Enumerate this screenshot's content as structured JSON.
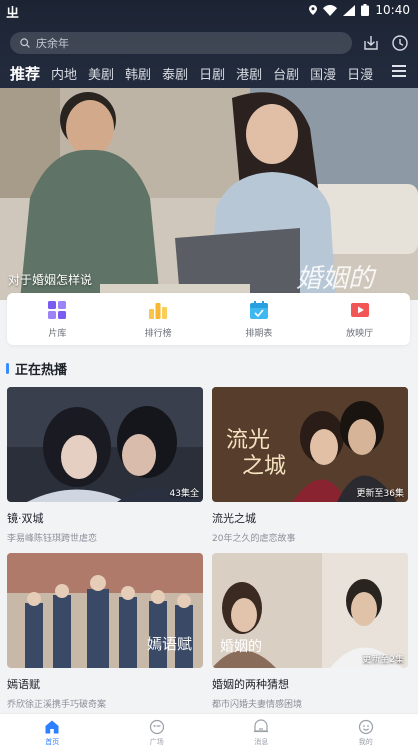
{
  "status_bar": {
    "time": "10:40",
    "app_glyph": "ㄓ"
  },
  "header": {
    "search": {
      "placeholder": "庆余年"
    },
    "tabs": [
      {
        "label": "推荐",
        "active": true
      },
      {
        "label": "内地"
      },
      {
        "label": "美剧"
      },
      {
        "label": "韩剧"
      },
      {
        "label": "泰剧"
      },
      {
        "label": "日剧"
      },
      {
        "label": "港剧"
      },
      {
        "label": "台剧"
      },
      {
        "label": "国漫"
      },
      {
        "label": "日漫"
      }
    ]
  },
  "banner": {
    "caption": "对于婚姻怎样说",
    "overlay_text": "婚姻的"
  },
  "shortcuts": [
    {
      "label": "片库",
      "icon": "grid-icon",
      "color": "#7b5cf0"
    },
    {
      "label": "排行榜",
      "icon": "ranking-icon",
      "color": "#f7b731"
    },
    {
      "label": "排期表",
      "icon": "calendar-icon",
      "color": "#3db8f0"
    },
    {
      "label": "放映厅",
      "icon": "play-icon",
      "color": "#f25555"
    }
  ],
  "section": {
    "title": "正在热播"
  },
  "shows": [
    {
      "title": "镜·双城",
      "desc": "李易峰陈钰琪跨世虐恋",
      "badge": "43集全"
    },
    {
      "title": "流光之城",
      "desc": "20年之久的虐恋故事",
      "badge": "更新至36集"
    },
    {
      "title": "嫣语赋",
      "desc": "乔欣徐正溪携手巧破奇案",
      "badge": ""
    },
    {
      "title": "婚姻的两种猜想",
      "desc": "都市闪婚夫妻情感困境",
      "badge": "更新至2集"
    }
  ],
  "bottom_nav": [
    {
      "label": "首页",
      "icon": "home-icon",
      "active": true
    },
    {
      "label": "广场",
      "icon": "plaza-icon"
    },
    {
      "label": "消息",
      "icon": "message-icon"
    },
    {
      "label": "我的",
      "icon": "profile-icon"
    }
  ],
  "colors": {
    "accent": "#2c7fff",
    "header_bg": "#1c2434",
    "section_bar": "#3a8dff"
  }
}
